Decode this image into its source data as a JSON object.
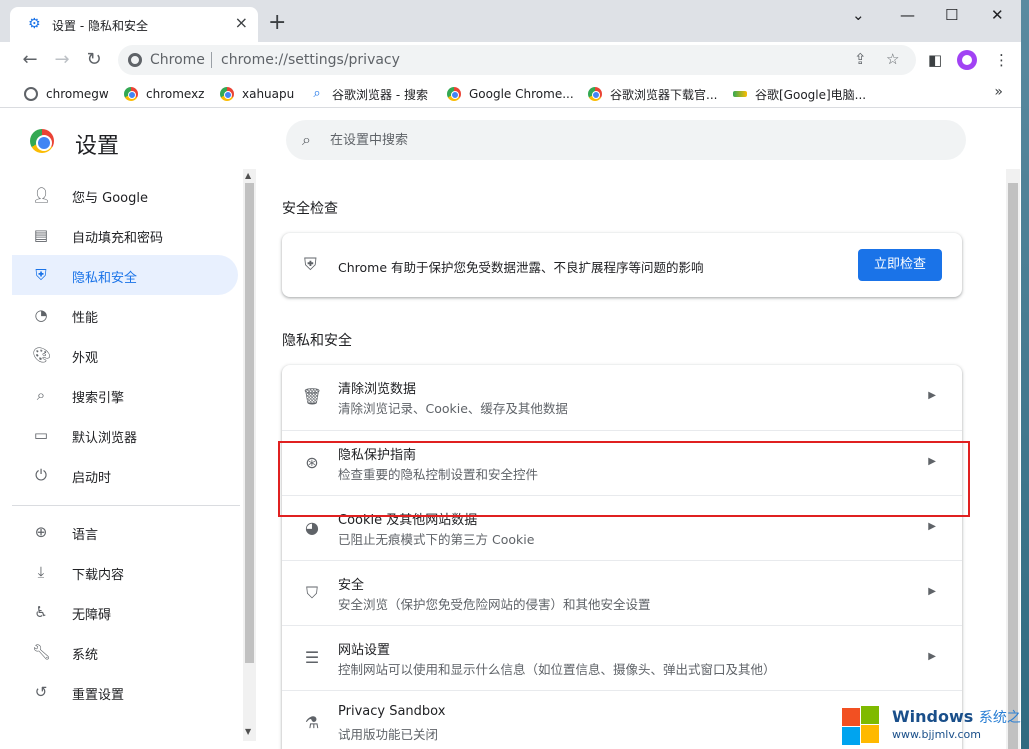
{
  "tab": {
    "title": "设置 - 隐私和安全",
    "icon": "gear-icon"
  },
  "window_controls": {
    "minimize": "⌄",
    "restore": "—",
    "maximize": "☐",
    "close": "✕"
  },
  "toolbar": {
    "chip": "Chrome",
    "url": "chrome://settings/privacy"
  },
  "bookmarks": [
    {
      "label": "chromegw",
      "icon": "globe-icon"
    },
    {
      "label": "chromexz",
      "icon": "chrome-icon"
    },
    {
      "label": "xahuapu",
      "icon": "chrome-icon"
    },
    {
      "label": "谷歌浏览器 - 搜索",
      "icon": "search-icon"
    },
    {
      "label": "Google Chrome...",
      "icon": "chrome-icon"
    },
    {
      "label": "谷歌浏览器下载官...",
      "icon": "chrome-icon"
    },
    {
      "label": "谷歌[Google]电脑...",
      "icon": "site-icon"
    }
  ],
  "settings": {
    "title": "设置",
    "search_placeholder": "在设置中搜索"
  },
  "sidebar": {
    "items": [
      {
        "label": "您与 Google",
        "icon": "person-icon",
        "active": false
      },
      {
        "label": "自动填充和密码",
        "icon": "clipboard-icon",
        "active": false
      },
      {
        "label": "隐私和安全",
        "icon": "shield-icon",
        "active": true
      },
      {
        "label": "性能",
        "icon": "gauge-icon",
        "active": false
      },
      {
        "label": "外观",
        "icon": "palette-icon",
        "active": false
      },
      {
        "label": "搜索引擎",
        "icon": "search-icon",
        "active": false
      },
      {
        "label": "默认浏览器",
        "icon": "browser-icon",
        "active": false
      },
      {
        "label": "启动时",
        "icon": "power-icon",
        "active": false
      },
      {
        "label": "语言",
        "icon": "globe-icon",
        "active": false
      },
      {
        "label": "下载内容",
        "icon": "download-icon",
        "active": false
      },
      {
        "label": "无障碍",
        "icon": "accessibility-icon",
        "active": false
      },
      {
        "label": "系统",
        "icon": "wrench-icon",
        "active": false
      },
      {
        "label": "重置设置",
        "icon": "reset-icon",
        "active": false
      }
    ]
  },
  "safety_check": {
    "heading": "安全检查",
    "text": "Chrome 有助于保护您免受数据泄露、不良扩展程序等问题的影响",
    "button": "立即检查"
  },
  "privacy": {
    "heading": "隐私和安全",
    "rows": [
      {
        "title": "清除浏览数据",
        "subtitle": "清除浏览记录、Cookie、缓存及其他数据",
        "icon": "trash-icon"
      },
      {
        "title": "隐私保护指南",
        "subtitle": "检查重要的隐私控制设置和安全控件",
        "icon": "compass-icon"
      },
      {
        "title": "Cookie 及其他网站数据",
        "subtitle": "已阻止无痕模式下的第三方 Cookie",
        "icon": "cookie-icon"
      },
      {
        "title": "安全",
        "subtitle": "安全浏览（保护您免受危险网站的侵害）和其他安全设置",
        "icon": "security-shield-icon"
      },
      {
        "title": "网站设置",
        "subtitle": "控制网站可以使用和显示什么信息（如位置信息、摄像头、弹出式窗口及其他）",
        "icon": "tune-icon"
      },
      {
        "title": "Privacy Sandbox",
        "subtitle": "试用版功能已关闭",
        "icon": "flask-icon"
      }
    ]
  },
  "watermark": {
    "brand": "Windows",
    "brand_cn": "系统之家",
    "url": "www.bjjmlv.com"
  },
  "colors": {
    "accent": "#1a73e8",
    "highlight": "#e02020",
    "active_bg": "#e8f0fe"
  }
}
